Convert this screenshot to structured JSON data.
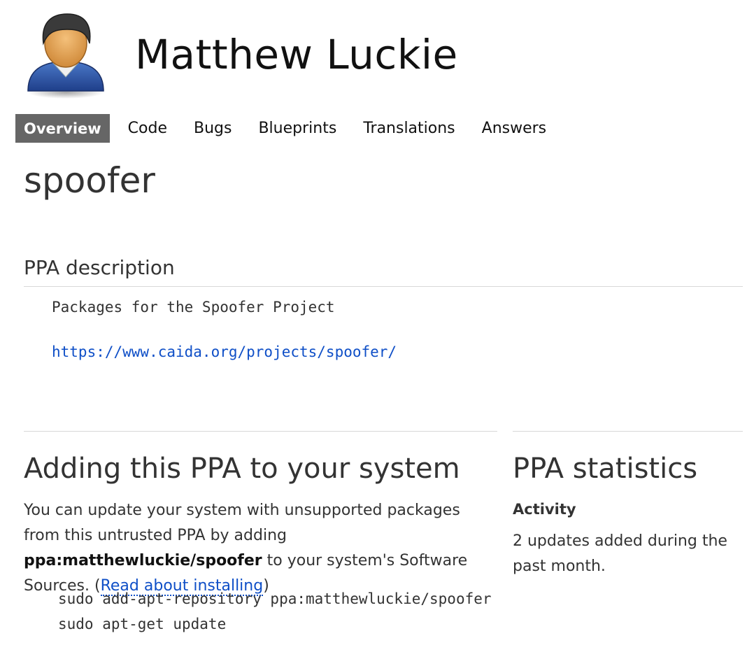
{
  "owner": {
    "name": "Matthew Luckie",
    "avatar_icon": "person-avatar-icon"
  },
  "tabs": [
    {
      "label": "Overview",
      "active": true
    },
    {
      "label": "Code",
      "active": false
    },
    {
      "label": "Bugs",
      "active": false
    },
    {
      "label": "Blueprints",
      "active": false
    },
    {
      "label": "Translations",
      "active": false
    },
    {
      "label": "Answers",
      "active": false
    }
  ],
  "page": {
    "title": "spoofer"
  },
  "description": {
    "heading": "PPA description",
    "text": "Packages for the Spoofer Project",
    "link": "https://www.caida.org/projects/spoofer/"
  },
  "adding": {
    "heading": "Adding this PPA to your system",
    "para_pre": "You can update your system with unsupported packages from this untrusted PPA by adding ",
    "ppa_name": "ppa:matthewluckie/spoofer",
    "para_mid": " to your system's Software Sources. (",
    "link_label": "Read about installing",
    "para_post": ")",
    "commands": [
      "sudo add-apt-repository ppa:matthewluckie/spoofer",
      "sudo apt-get update"
    ]
  },
  "stats": {
    "heading": "PPA statistics",
    "activity_label": "Activity",
    "activity_text": "2 updates added during the past month."
  },
  "colors": {
    "link": "#0f4fc7",
    "active_tab_bg": "#666666",
    "rule": "#d8d8d8"
  }
}
